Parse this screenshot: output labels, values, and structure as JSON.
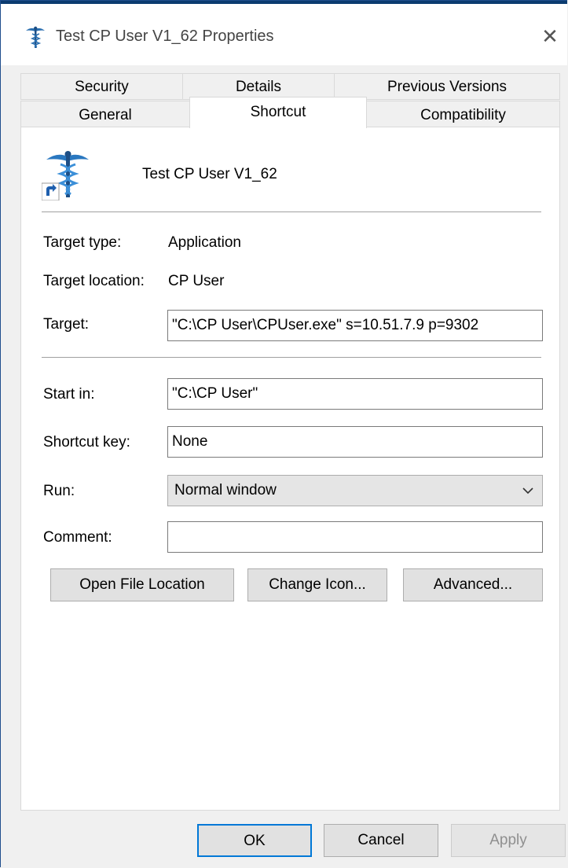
{
  "window": {
    "title": "Test CP User V1_62 Properties",
    "close_glyph": "✕"
  },
  "tabs": {
    "row1": [
      "Security",
      "Details",
      "Previous Versions"
    ],
    "row2": [
      "General",
      "Shortcut",
      "Compatibility"
    ],
    "selected": "Shortcut"
  },
  "shortcut": {
    "app_name": "Test CP User V1_62",
    "target_type_label": "Target type:",
    "target_type_value": "Application",
    "target_location_label": "Target location:",
    "target_location_value": "CP User",
    "target_label": "Target:",
    "target_value": "\"C:\\CP User\\CPUser.exe\" s=10.51.7.9 p=9302",
    "start_in_label": "Start in:",
    "start_in_value": "\"C:\\CP User\"",
    "shortcut_key_label": "Shortcut key:",
    "shortcut_key_value": "None",
    "run_label": "Run:",
    "run_value": "Normal window",
    "comment_label": "Comment:",
    "comment_value": "",
    "open_file_location": "Open File Location",
    "change_icon": "Change Icon...",
    "advanced": "Advanced..."
  },
  "footer": {
    "ok": "OK",
    "cancel": "Cancel",
    "apply": "Apply"
  },
  "colors": {
    "accent": "#0b3b6f",
    "dialog_bg": "#f0f0f0",
    "panel_bg": "#ffffff"
  }
}
